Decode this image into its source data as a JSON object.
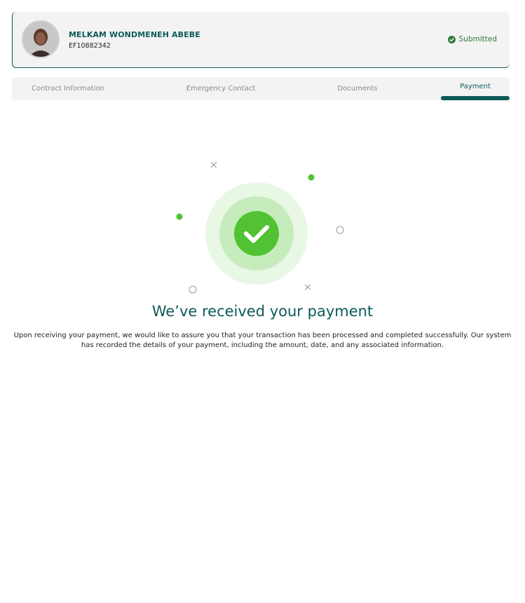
{
  "profile": {
    "name": "MELKAM WONDMENEH ABEBE",
    "id": "EF10882342",
    "status": "Submitted",
    "status_color": "#2d7a3a"
  },
  "tabs": [
    {
      "label": "Contract Information",
      "active": false
    },
    {
      "label": "Emergency Contact",
      "active": false
    },
    {
      "label": "Documents",
      "active": false
    },
    {
      "label": "Payment",
      "active": true
    }
  ],
  "success": {
    "title": "We’ve received your payment",
    "message": "Upon receiving your payment, we would like to assure you that your transaction has been processed and completed successfully. Our system has recorded the details of your payment, including the amount, date, and any associated information."
  },
  "colors": {
    "brand": "#0e5a5a",
    "success_green": "#52c234",
    "panel_bg": "#f3f3f3"
  },
  "icons": {
    "status": "check-circle-icon",
    "success": "checkmark-icon"
  }
}
